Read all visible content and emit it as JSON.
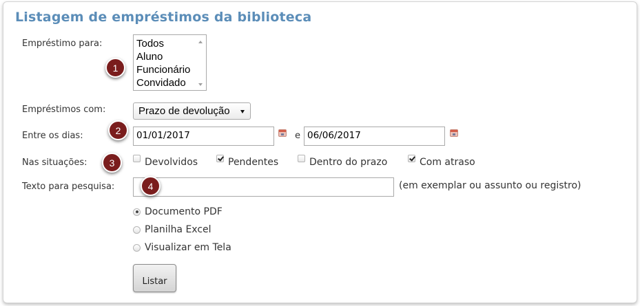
{
  "title": "Listagem de empréstimos da biblioteca",
  "labels": {
    "emprestimo_para": "Empréstimo para:",
    "emprestimos_com": "Empréstimos com:",
    "entre_dias": "Entre os dias:",
    "situacoes": "Nas situações:",
    "texto_pesquisa": "Texto para pesquisa:"
  },
  "emprestimo_para_options": [
    "Todos",
    "Aluno",
    "Funcionário",
    "Convidado"
  ],
  "emprestimos_com": {
    "selected": "Prazo de devolução"
  },
  "date_range": {
    "start": "01/01/2017",
    "separator": "e",
    "end": "06/06/2017"
  },
  "situacoes": [
    {
      "label": "Devolvidos",
      "checked": false
    },
    {
      "label": "Pendentes",
      "checked": true
    },
    {
      "label": "Dentro do prazo",
      "checked": false
    },
    {
      "label": "Com atraso",
      "checked": true
    }
  ],
  "search": {
    "value": "",
    "hint": "(em exemplar ou assunto ou registro)"
  },
  "output_format": [
    {
      "label": "Documento PDF",
      "checked": true
    },
    {
      "label": "Planilha Excel",
      "checked": false
    },
    {
      "label": "Visualizar em Tela",
      "checked": false
    }
  ],
  "list_button": "Listar",
  "markers": [
    "1",
    "2",
    "3",
    "4"
  ],
  "colors": {
    "title": "#5b8db8",
    "marker": "#7a1d1d"
  }
}
